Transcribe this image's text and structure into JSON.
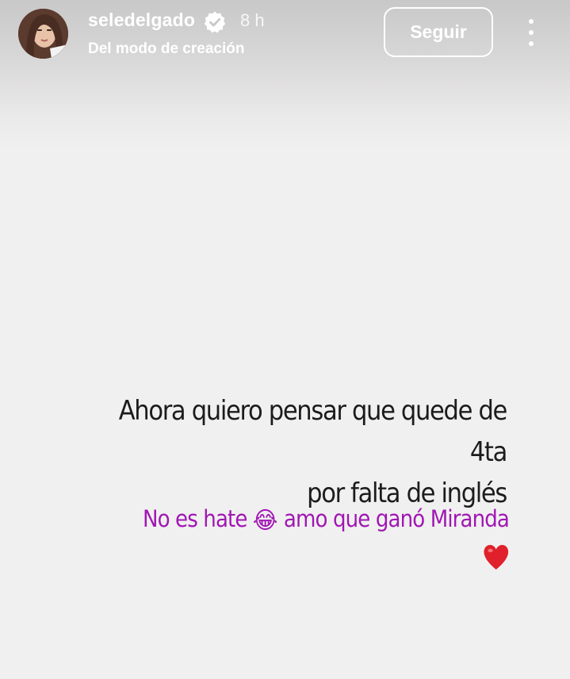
{
  "header": {
    "username": "seledelgado",
    "verified_icon": "verified-badge-icon",
    "time": "8 h",
    "subtitle": "Del modo de creación",
    "follow_label": "Seguir",
    "more_icon": "more-vertical-icon"
  },
  "story": {
    "line1": "Ahora quiero pensar que quede de 4ta",
    "line2": "por falta de inglés",
    "note_part1": "No es hate ",
    "note_emoji": "😂",
    "note_part2": " amo que ganó Miranda",
    "heart_icon": "red-heart-icon"
  },
  "colors": {
    "background": "#f1f0f0",
    "main_text": "#1c1c1c",
    "accent_text": "#a017b4",
    "heart": "#e0202a"
  }
}
